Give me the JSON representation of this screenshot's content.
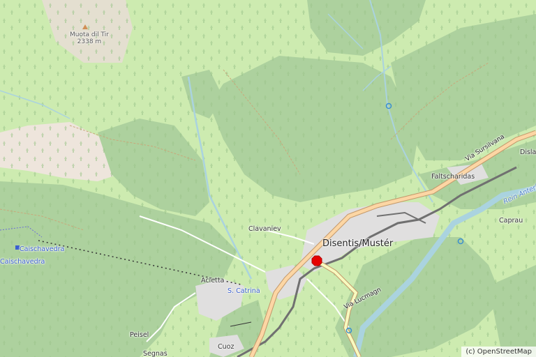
{
  "map": {
    "peak": {
      "name": "Muota dil Tir",
      "elevation": "2338 m"
    },
    "places": {
      "disentis": "Disentis/Mustér",
      "clavaniev": "Clavaniev",
      "acletta": "Acletta",
      "s_catrina": "S. Catrina",
      "caischavedra_station": "Caischavedra",
      "caischavedra": "Caischavedra",
      "peisel": "Peisel",
      "cuoz": "Cuoz",
      "segnas": "Segnas",
      "faltscharidas": "Faltscharidas",
      "caprau": "Caprau",
      "disla": "Disla"
    },
    "roads": {
      "via_sursilvana": "Via Sursilvana",
      "via_lucmagn": "Via Lucmagn"
    },
    "water": {
      "rein_anteriur": "Rein Anterior"
    },
    "attribution": "(c) OpenStreetMap",
    "colors": {
      "forest": "#add19e",
      "meadow": "#cdebb0",
      "rock": "#eee5dc",
      "residential": "#e0dfdf",
      "primary_road": "#fcd6a4",
      "primary_casing": "#c3986a",
      "water": "#aad3df",
      "marker": "#e60000"
    }
  }
}
